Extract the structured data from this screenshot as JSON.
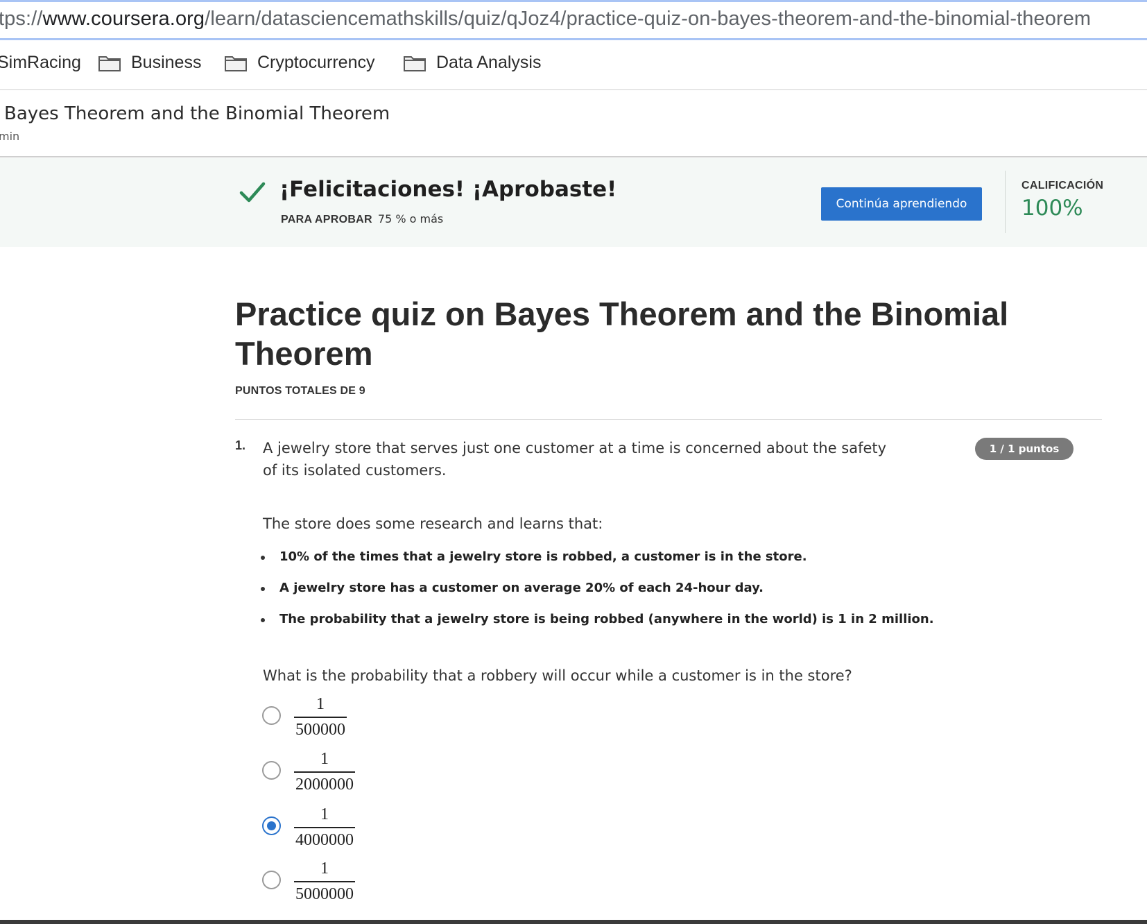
{
  "browser": {
    "url_proto": "tps://",
    "url_host": "www.coursera.org",
    "url_path": "/learn/datasciencemathskills/quiz/qJoz4/practice-quiz-on-bayes-theorem-and-the-binomial-theorem"
  },
  "bookmarks": [
    {
      "label": "SimRacing"
    },
    {
      "label": "Business",
      "icon": "folder-icon"
    },
    {
      "label": "Cryptocurrency",
      "icon": "folder-icon"
    },
    {
      "label": "Data Analysis",
      "icon": "folder-icon"
    }
  ],
  "course": {
    "title": "Bayes Theorem and the Binomial Theorem",
    "subtitle": "min"
  },
  "banner": {
    "message": "¡Felicitaciones! ¡Aprobaste!",
    "pass_label": "PARA APROBAR",
    "pass_value": "75 % o más",
    "continue_label": "Continúa aprendiendo",
    "grade_label": "CALIFICACIÓN",
    "grade_value": "100%",
    "success_color": "#2d8a57",
    "button_color": "#2a73cc"
  },
  "quiz": {
    "title": "Practice quiz on Bayes Theorem and the Binomial Theorem",
    "points_total": "PUNTOS TOTALES DE 9"
  },
  "question": {
    "number": "1.",
    "text": "A jewelry store that serves just one customer at a time is concerned about the safety of its isolated customers.",
    "points": "1 / 1 puntos",
    "intro": "The store does some research and learns that:",
    "facts": [
      "10% of the times that a jewelry store is robbed, a customer is in the store.",
      "A jewelry store has a customer on average 20% of each 24-hour day.",
      "The probability that a jewelry store is being robbed (anywhere in the world) is 1 in 2 million."
    ],
    "ask": "What is the probability that a robbery will occur while a customer is in the store?",
    "options": [
      {
        "numerator": "1",
        "denominator": "500000",
        "selected": false
      },
      {
        "numerator": "1",
        "denominator": "2000000",
        "selected": false
      },
      {
        "numerator": "1",
        "denominator": "4000000",
        "selected": true
      },
      {
        "numerator": "1",
        "denominator": "5000000",
        "selected": false
      }
    ]
  }
}
